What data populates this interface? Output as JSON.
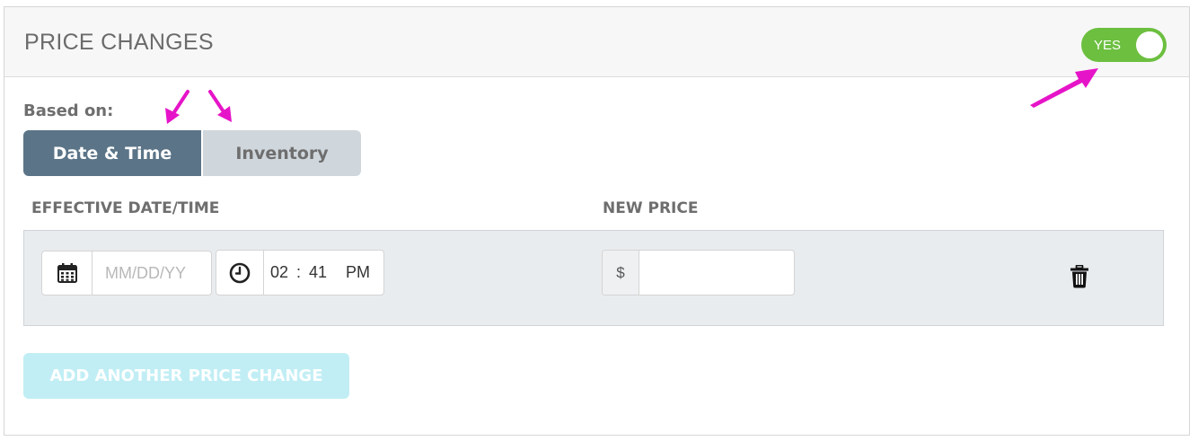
{
  "panel": {
    "title": "PRICE CHANGES",
    "toggle": {
      "label": "YES",
      "state": "on",
      "color": "#6cbf3f"
    }
  },
  "based_on": {
    "label": "Based on:",
    "options": [
      "Date & Time",
      "Inventory"
    ],
    "selected": "Date & Time"
  },
  "columns": {
    "effective": "EFFECTIVE DATE/TIME",
    "new_price": "NEW PRICE"
  },
  "row": {
    "date_placeholder": "MM/DD/YY",
    "time_hour": "02",
    "time_sep": ":",
    "time_minute": "41",
    "time_period": "PM",
    "currency_symbol": "$",
    "price_value": ""
  },
  "add_button_label": "ADD ANOTHER PRICE CHANGE",
  "icons": {
    "date": "calendar-icon",
    "time": "clock-icon",
    "delete": "trash-icon",
    "annotation": "pointer-arrow-icon"
  },
  "colors": {
    "selected_segment": "#5b7487",
    "unselected_segment": "#cfd6dc",
    "add_button": "#c1eef4",
    "annotation_arrow": "#e614c8"
  }
}
